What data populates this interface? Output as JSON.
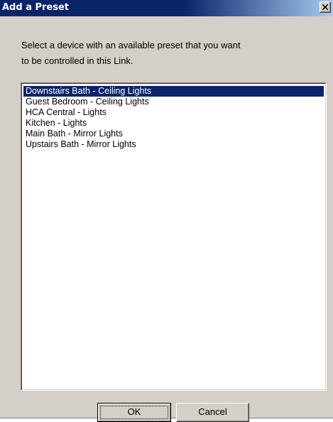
{
  "window": {
    "title": "Add a Preset",
    "close_icon": "close-x-icon"
  },
  "instruction": "Select a device with an available preset that you want\nto be controlled in this Link.",
  "device_list": {
    "items": [
      {
        "label": "Downstairs Bath - Ceiling Lights",
        "selected": true
      },
      {
        "label": "Guest Bedroom - Ceiling Lights",
        "selected": false
      },
      {
        "label": "HCA Central - Lights",
        "selected": false
      },
      {
        "label": "Kitchen - Lights",
        "selected": false
      },
      {
        "label": "Main Bath - Mirror Lights",
        "selected": false
      },
      {
        "label": "Upstairs Bath - Mirror Lights",
        "selected": false
      }
    ]
  },
  "buttons": {
    "ok_label": "OK",
    "cancel_label": "Cancel"
  },
  "colors": {
    "title_bar": "#0a246a",
    "selection": "#0a246a",
    "dialog_face": "#d4d0c8"
  }
}
